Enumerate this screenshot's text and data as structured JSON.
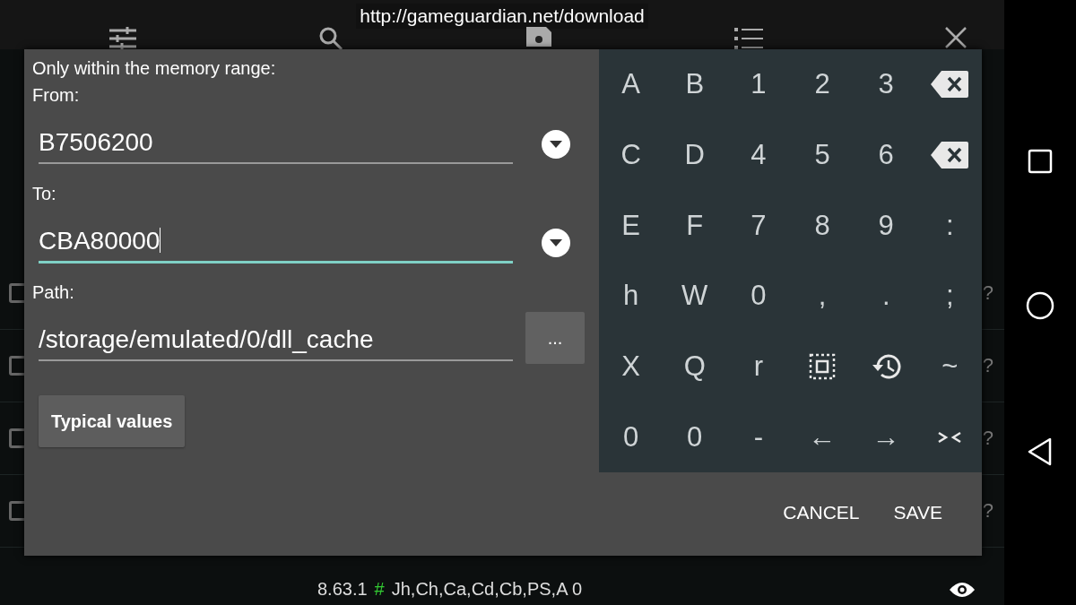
{
  "url_banner": "http://gameguardian.net/download",
  "toolbar": [
    {
      "kind": "sliders"
    },
    {
      "kind": "search"
    },
    {
      "kind": "save"
    },
    {
      "kind": "list"
    },
    {
      "kind": "close"
    }
  ],
  "list_rows": [
    {
      "checked": false,
      "hint": "?"
    },
    {
      "checked": false,
      "hint": "?"
    },
    {
      "checked": false,
      "hint": "?"
    },
    {
      "checked": false,
      "hint": "?"
    }
  ],
  "dialog": {
    "heading": "Only within the memory range:",
    "fields": [
      {
        "label": "From:",
        "value": "B7506200",
        "focused": false,
        "kind": "dropdown"
      },
      {
        "label": "To:",
        "value": "CBA80000",
        "focused": true,
        "kind": "dropdown"
      },
      {
        "label": "Path:",
        "value": "/storage/emulated/0/dll_cache",
        "focused": false,
        "kind": "browse",
        "button": "..."
      }
    ],
    "typical_button": "Typical values",
    "buttons": [
      "CANCEL",
      "SAVE"
    ]
  },
  "keyboard": [
    [
      {
        "kind": "text",
        "label": "A"
      },
      {
        "kind": "text",
        "label": "B"
      },
      {
        "kind": "text",
        "label": "1"
      },
      {
        "kind": "text",
        "label": "2"
      },
      {
        "kind": "text",
        "label": "3"
      },
      {
        "kind": "backspace"
      }
    ],
    [
      {
        "kind": "text",
        "label": "C"
      },
      {
        "kind": "text",
        "label": "D"
      },
      {
        "kind": "text",
        "label": "4"
      },
      {
        "kind": "text",
        "label": "5"
      },
      {
        "kind": "text",
        "label": "6"
      },
      {
        "kind": "delete"
      }
    ],
    [
      {
        "kind": "text",
        "label": "E"
      },
      {
        "kind": "text",
        "label": "F"
      },
      {
        "kind": "text",
        "label": "7"
      },
      {
        "kind": "text",
        "label": "8"
      },
      {
        "kind": "text",
        "label": "9"
      },
      {
        "kind": "text",
        "label": ":"
      }
    ],
    [
      {
        "kind": "text",
        "label": "h"
      },
      {
        "kind": "text",
        "label": "W"
      },
      {
        "kind": "text",
        "label": "0"
      },
      {
        "kind": "text",
        "label": ","
      },
      {
        "kind": "text",
        "label": "."
      },
      {
        "kind": "text",
        "label": ";"
      }
    ],
    [
      {
        "kind": "text",
        "label": "X"
      },
      {
        "kind": "text",
        "label": "Q"
      },
      {
        "kind": "text",
        "label": "r"
      },
      {
        "kind": "select"
      },
      {
        "kind": "history"
      },
      {
        "kind": "text",
        "label": "~"
      }
    ],
    [
      {
        "kind": "text",
        "label": "0"
      },
      {
        "kind": "text",
        "label": "0"
      },
      {
        "kind": "text",
        "label": "-"
      },
      {
        "kind": "text",
        "label": "←"
      },
      {
        "kind": "text",
        "label": "→"
      },
      {
        "kind": "collapse"
      }
    ]
  ],
  "status_bar": {
    "version": "8.63.1",
    "hash": "#",
    "flags": "Jh,Ch,Ca,Cd,Cb,PS,A 0"
  },
  "nav_bar": [
    {
      "kind": "recents"
    },
    {
      "kind": "home"
    },
    {
      "kind": "back"
    }
  ]
}
